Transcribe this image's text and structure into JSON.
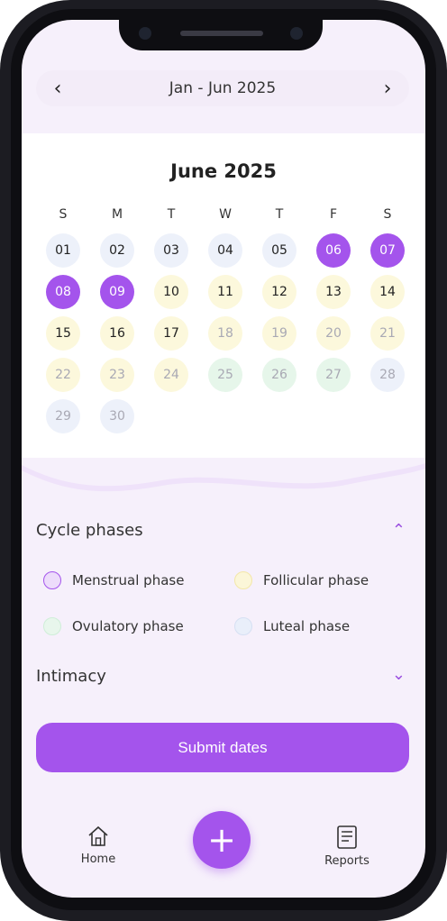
{
  "range_bar": {
    "prev_icon": "chevron-left-icon",
    "label": "Jan - Jun 2025",
    "next_icon": "chevron-right-icon"
  },
  "calendar": {
    "month_title": "June 2025",
    "weekdays": [
      "S",
      "M",
      "T",
      "W",
      "T",
      "F",
      "S"
    ],
    "days": [
      {
        "n": "01",
        "phase": "luteal",
        "muted": false
      },
      {
        "n": "02",
        "phase": "luteal",
        "muted": false
      },
      {
        "n": "03",
        "phase": "luteal",
        "muted": false
      },
      {
        "n": "04",
        "phase": "luteal",
        "muted": false
      },
      {
        "n": "05",
        "phase": "luteal",
        "muted": false
      },
      {
        "n": "06",
        "phase": "selected",
        "muted": false
      },
      {
        "n": "07",
        "phase": "selected",
        "muted": false
      },
      {
        "n": "08",
        "phase": "selected",
        "muted": false
      },
      {
        "n": "09",
        "phase": "selected",
        "muted": false
      },
      {
        "n": "10",
        "phase": "follicular",
        "muted": false
      },
      {
        "n": "11",
        "phase": "follicular",
        "muted": false
      },
      {
        "n": "12",
        "phase": "follicular",
        "muted": false
      },
      {
        "n": "13",
        "phase": "follicular",
        "muted": false
      },
      {
        "n": "14",
        "phase": "follicular",
        "muted": false
      },
      {
        "n": "15",
        "phase": "follicular",
        "muted": false
      },
      {
        "n": "16",
        "phase": "follicular",
        "muted": false
      },
      {
        "n": "17",
        "phase": "follicular",
        "muted": false
      },
      {
        "n": "18",
        "phase": "follicular",
        "muted": true
      },
      {
        "n": "19",
        "phase": "follicular",
        "muted": true
      },
      {
        "n": "20",
        "phase": "follicular",
        "muted": true
      },
      {
        "n": "21",
        "phase": "follicular",
        "muted": true
      },
      {
        "n": "22",
        "phase": "follicular",
        "muted": true
      },
      {
        "n": "23",
        "phase": "follicular",
        "muted": true
      },
      {
        "n": "24",
        "phase": "follicular",
        "muted": true
      },
      {
        "n": "25",
        "phase": "ovulatory",
        "muted": true
      },
      {
        "n": "26",
        "phase": "ovulatory",
        "muted": true
      },
      {
        "n": "27",
        "phase": "ovulatory",
        "muted": true
      },
      {
        "n": "28",
        "phase": "luteal",
        "muted": true
      },
      {
        "n": "29",
        "phase": "luteal",
        "muted": true
      },
      {
        "n": "30",
        "phase": "luteal",
        "muted": true
      }
    ],
    "first_weekday_index": 0
  },
  "cycle_phases": {
    "title": "Cycle phases",
    "expanded_icon": "chevron-up-icon",
    "items": [
      {
        "label": "Menstrual phase",
        "fill": "#eddcfb",
        "border": "#a454ec"
      },
      {
        "label": "Follicular phase",
        "fill": "#fbf6d8",
        "border": "#f3e7a8"
      },
      {
        "label": "Ovulatory phase",
        "fill": "#e8f6ec",
        "border": "#cfeed8"
      },
      {
        "label": "Luteal phase",
        "fill": "#e9effa",
        "border": "#d6e0f3"
      }
    ]
  },
  "intimacy": {
    "title": "Intimacy",
    "collapsed_icon": "chevron-down-icon"
  },
  "submit_label": "Submit dates",
  "bottom_nav": {
    "home_label": "Home",
    "home_icon": "home-icon",
    "add_icon": "plus-icon",
    "reports_label": "Reports",
    "reports_icon": "report-icon"
  },
  "colors": {
    "accent": "#a454ec",
    "selected_fill": "#a454ec",
    "follicular": "#fcf8dc",
    "luteal": "#edf1fa",
    "ovulatory": "#e6f6ea"
  }
}
